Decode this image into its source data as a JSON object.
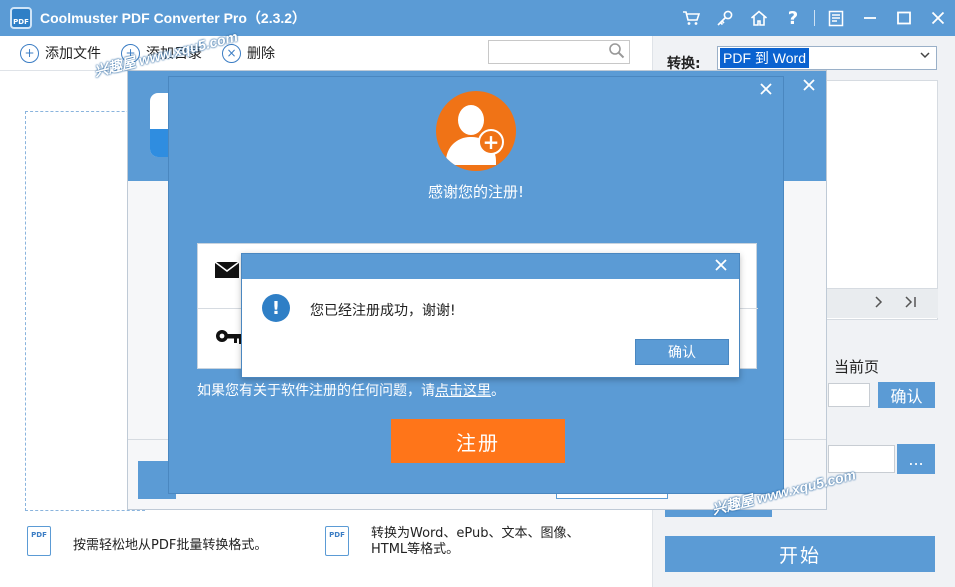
{
  "window": {
    "title": "Coolmuster PDF Converter Pro（2.3.2）",
    "logo_text": "PDF",
    "title_icons": [
      "cart-icon",
      "key-icon",
      "home-icon",
      "help-icon",
      "register-icon",
      "minimize-icon",
      "maximize-icon",
      "close-icon"
    ]
  },
  "toolbar": {
    "add_file": "添加文件",
    "add_folder": "添加目录",
    "delete": "删除",
    "search_placeholder": ""
  },
  "right_panel": {
    "convert_label": "转换:",
    "convert_value": "PDF 到 Word",
    "current_page_label": "当前页",
    "confirm_label": "确认",
    "browse_label": "...",
    "start_label": "开始"
  },
  "features": [
    {
      "icon": "PDF",
      "text": "按需轻松地从PDF批量转换格式。"
    },
    {
      "icon": "PDF",
      "text_line1": "转换为Word、ePub、文本、图像、",
      "text_line2": "HTML等格式。"
    }
  ],
  "register_dialog": {
    "thanks": "感谢您的注册!",
    "help_prefix": "如果您有关于软件注册的任何问题，请",
    "help_link": "点击这里",
    "help_suffix": "。",
    "submit_label": "注册"
  },
  "message_box": {
    "text": "您已经注册成功，谢谢!",
    "ok_label": "确认"
  },
  "watermark": {
    "text": "兴趣屋 www.xqu5.com"
  },
  "colors": {
    "brand_blue": "#5b9bd5",
    "accent_orange": "#ff7519"
  }
}
